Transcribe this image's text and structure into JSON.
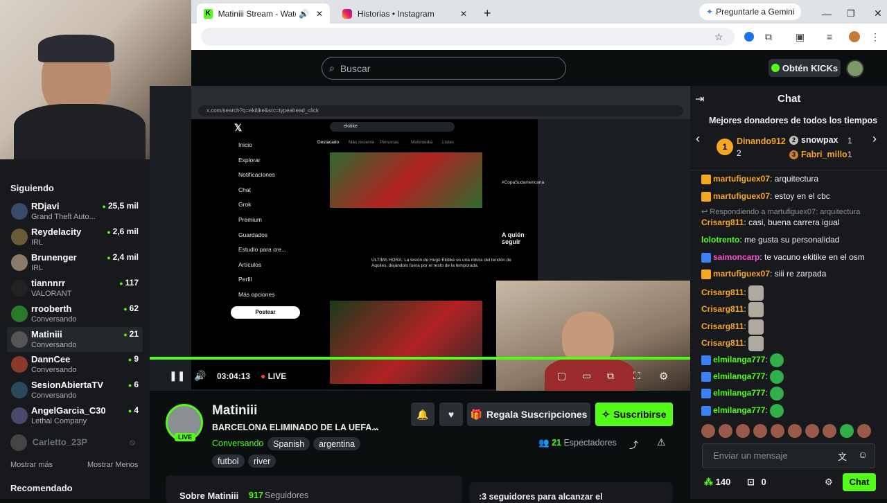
{
  "browser": {
    "tabs": [
      {
        "title": "Matiniii Stream - Watch Liv",
        "active": true
      },
      {
        "title": "Historias • Instagram",
        "active": false
      }
    ],
    "gemini_label": "Preguntarle a Gemini"
  },
  "header": {
    "search_placeholder": "Buscar",
    "kicks_label": "Obtén KICKs"
  },
  "sidebar": {
    "following_label": "Siguiendo",
    "channels": [
      {
        "name": "RDjavi",
        "category": "Grand Theft Auto...",
        "viewers": "25,5 mil"
      },
      {
        "name": "Reydelacity",
        "category": "IRL",
        "viewers": "2,6 mil"
      },
      {
        "name": "Brunenger",
        "category": "IRL",
        "viewers": "2,4 mil"
      },
      {
        "name": "tiannnrr",
        "category": "VALORANT",
        "viewers": "117"
      },
      {
        "name": "rrooberth",
        "category": "Conversando",
        "viewers": "62"
      },
      {
        "name": "Matiniii",
        "category": "Conversando",
        "viewers": "21"
      },
      {
        "name": "DannCee",
        "category": "Conversando",
        "viewers": "9"
      },
      {
        "name": "SesionAbiertaTV",
        "category": "Conversando",
        "viewers": "6"
      },
      {
        "name": "AngelGarcia_C30",
        "category": "Lethal Company",
        "viewers": "4"
      }
    ],
    "offline_channel": "Carletto_23P",
    "show_more": "Mostrar más",
    "show_less": "Mostrar Menos",
    "recommended_label": "Recomendado"
  },
  "video": {
    "time": "03:04:13",
    "live_label": "LIVE",
    "inner_search": "x.com/search?q=ekitike&src=typeahead_click",
    "x_nav": [
      "Inicio",
      "Explorar",
      "Notificaciones",
      "Chat",
      "Grok",
      "Premium",
      "Guardados",
      "Estudio para cre...",
      "Artículos",
      "Perfil",
      "Más opciones"
    ],
    "x_post_button": "Postear",
    "x_search_query": "ekitike",
    "x_tabs": [
      "Destacado",
      "Más reciente",
      "Personas",
      "Multimedia",
      "Listas"
    ],
    "x_who_to_follow": "A quién seguir",
    "x_trend": "#CopaSudamericana",
    "x_tweet_headline": "ÚLTIMA HORA: La lesión de Hugo Ekitike es una rotura del tendón de Aquiles, dejándolo fuera por el resto de la temporada."
  },
  "channel": {
    "name": "Matiniii",
    "title": "BARCELONA ELIMINADO DE LA UEFA...",
    "category": "Conversando",
    "tags": [
      "Spanish",
      "argentina",
      "futbol",
      "river"
    ],
    "live_badge": "LIVE",
    "gift_button": "Regala Suscripciones",
    "subscribe_button": "Suscribirse",
    "viewers_count": "21",
    "viewers_label": "Espectadores",
    "about_label": "Sobre Matiniii",
    "followers_count": "917",
    "followers_label": "Seguidores",
    "goal_text": ":3 seguidores para alcanzar el"
  },
  "chat": {
    "title": "Chat",
    "top_donors_label": "Mejores donadores de todos los tiempos",
    "donors": [
      {
        "rank": "1",
        "name": "Dinando912",
        "count": "2"
      },
      {
        "rank": "2",
        "name": "snowpax",
        "count": "1"
      },
      {
        "rank": "3",
        "name": "Fabri_millo",
        "count": "1"
      }
    ],
    "messages": [
      {
        "user": "martufiguex07",
        "text": "arquitectura",
        "color": "#f5a623"
      },
      {
        "user": "martufiguex07",
        "text": "estoy en el cbc",
        "color": "#f5a623"
      },
      {
        "reply": "Respondiendo a martufiguex07: arquitectura"
      },
      {
        "user": "Crisarg811",
        "text": "casi, buena carrera igual",
        "color": "#f5a623"
      },
      {
        "user": "lolotrento",
        "text": "me gusta su personalidad",
        "color": "#53fc18"
      },
      {
        "user": "saimoncarp",
        "text": "te vacuno ekitike en el osm",
        "color": "#ff4fd8"
      },
      {
        "user": "martufiguex07",
        "text": "siii re zarpada",
        "color": "#f5a623"
      },
      {
        "user": "Crisarg811",
        "text": "",
        "color": "#f5a623"
      },
      {
        "user": "Crisarg811",
        "text": "",
        "color": "#f5a623"
      },
      {
        "user": "Crisarg811",
        "text": "",
        "color": "#f5a623"
      },
      {
        "user": "Crisarg811",
        "text": "",
        "color": "#f5a623"
      },
      {
        "user": "elmilanga777",
        "text": "",
        "color": "#53fc18"
      },
      {
        "user": "elmilanga777",
        "text": "",
        "color": "#53fc18"
      },
      {
        "user": "elmilanga777",
        "text": "",
        "color": "#53fc18"
      },
      {
        "user": "elmilanga777",
        "text": "",
        "color": "#53fc18"
      }
    ],
    "input_placeholder": "Enviar un mensaje",
    "points": "140",
    "gift_count": "0",
    "send_button": "Chat"
  },
  "colors": {
    "accent": "#53fc18",
    "background": "#0b0e0f",
    "panel": "#17191c"
  }
}
